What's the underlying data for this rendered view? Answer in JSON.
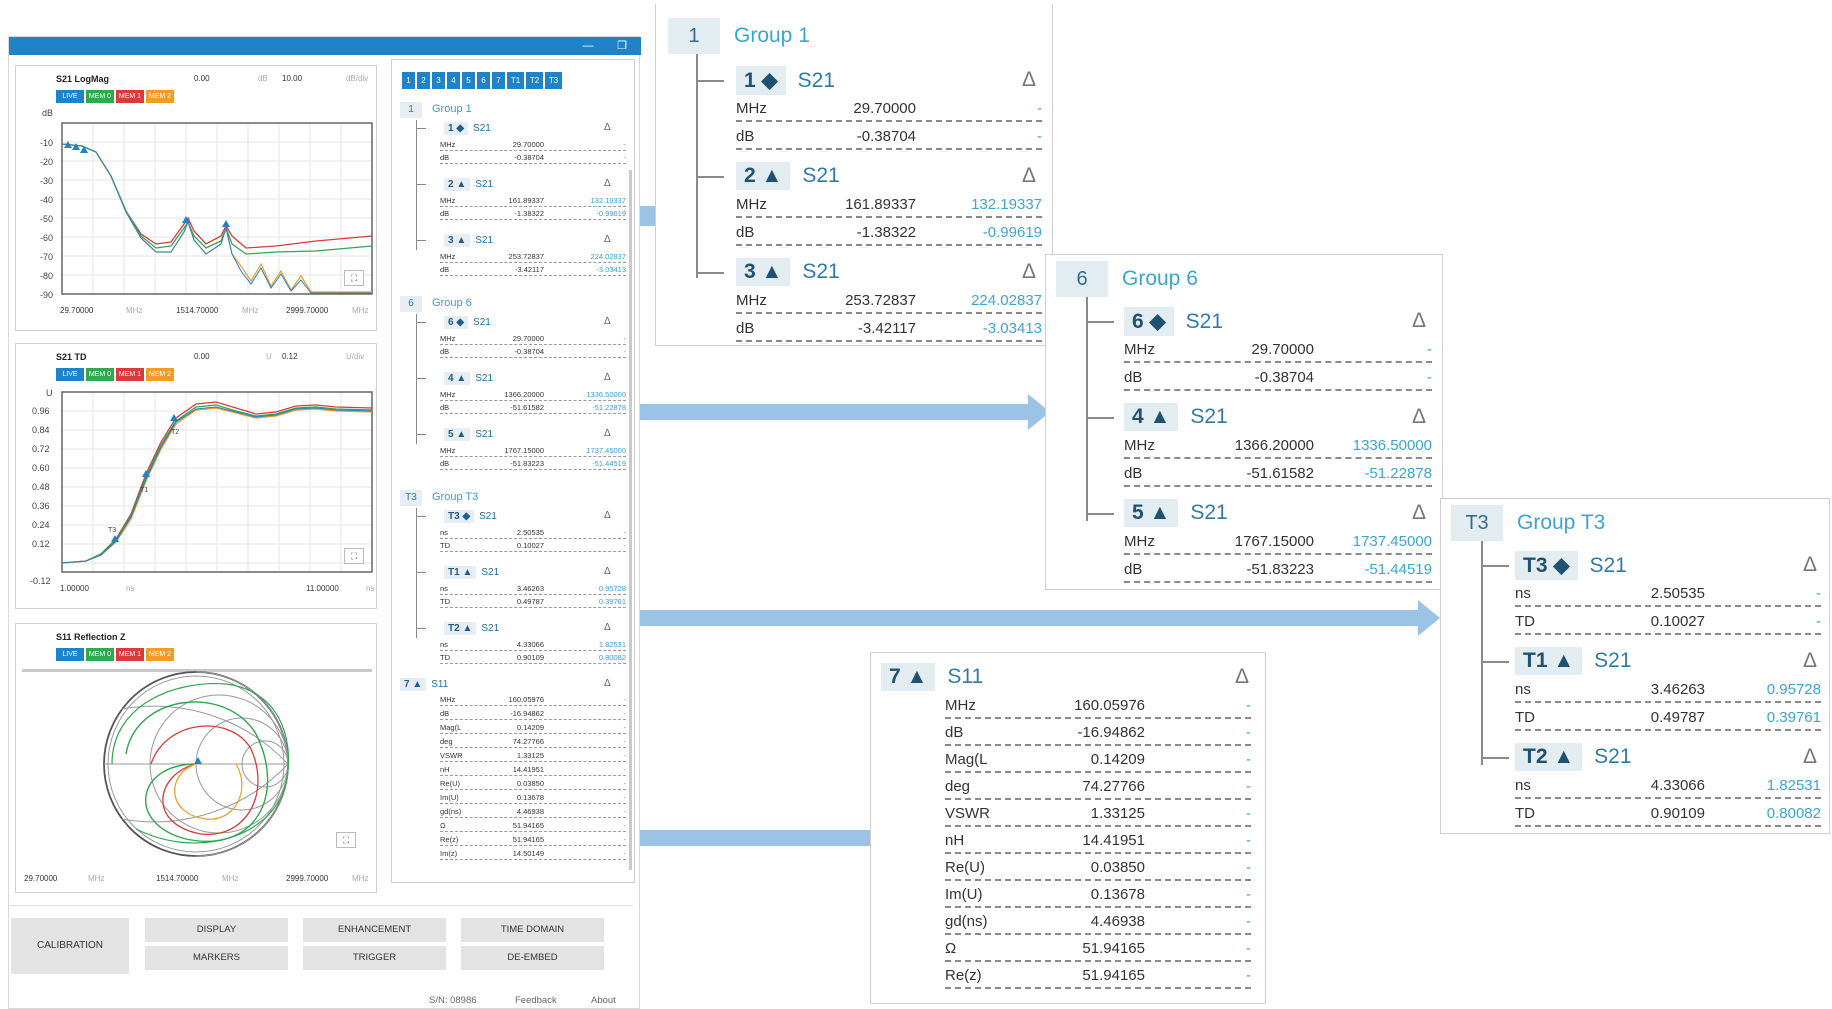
{
  "colors": {
    "accent": "#1f83c9",
    "live": "#1f83c9",
    "mem0": "#2fa84f",
    "mem1": "#d93a3a",
    "mem2": "#f39b24",
    "delta_text": "#3ba6cd"
  },
  "window": {
    "min_icon": "minimize-icon",
    "restore_icon": "restore-icon"
  },
  "mem_labels": [
    "LIVE",
    "MEM 0",
    "MEM 1",
    "MEM 2"
  ],
  "plot1": {
    "title": "S21 LogMag",
    "ref": "0.00",
    "ref_unit": "dB",
    "scale": "10.00",
    "scale_unit": "dB/div",
    "y_unit": "dB",
    "y_ticks": [
      "-10",
      "-20",
      "-30",
      "-40",
      "-50",
      "-60",
      "-70",
      "-80",
      "-90"
    ],
    "x_start": "29.70000",
    "x_start_unit": "MHz",
    "x_mid": "1514.70000",
    "x_mid_unit": "MHz",
    "x_end": "2999.70000",
    "x_end_unit": "MHz",
    "markers": [
      "1",
      "2",
      "3",
      "4",
      "5"
    ]
  },
  "plot2": {
    "title": "S21 TD",
    "ref": "0.00",
    "ref_unit": "U",
    "scale": "0.12",
    "scale_unit": "U/div",
    "y_unit": "U",
    "y_ticks": [
      "0.96",
      "0.84",
      "0.72",
      "0.60",
      "0.48",
      "0.36",
      "0.24",
      "0.12",
      "-0.12"
    ],
    "x_start": "1.00000",
    "x_start_unit": "ns",
    "x_end": "11.00000",
    "x_end_unit": "ns",
    "markers": [
      "T1",
      "T2",
      "T3"
    ]
  },
  "plot3": {
    "title": "S11 Reflection Z",
    "x_start": "29.70000",
    "x_start_unit": "MHz",
    "x_mid": "1514.70000",
    "x_mid_unit": "MHz",
    "x_end": "2999.70000",
    "x_end_unit": "MHz"
  },
  "marker_tabs": [
    "1",
    "2",
    "3",
    "4",
    "5",
    "6",
    "7",
    "T1",
    "T2",
    "T3"
  ],
  "delta_symbol": "Δ",
  "groups": {
    "g1": {
      "id": "1",
      "label": "Group 1",
      "m1": {
        "id": "1 ◆",
        "trace": "S21",
        "rows": [
          [
            "MHz",
            "29.70000",
            "-"
          ],
          [
            "dB",
            "-0.38704",
            "-"
          ]
        ]
      },
      "m2": {
        "id": "2 ▲",
        "trace": "S21",
        "rows": [
          [
            "MHz",
            "161.89337",
            "132.19337"
          ],
          [
            "dB",
            "-1.38322",
            "-0.99619"
          ]
        ]
      },
      "m3": {
        "id": "3 ▲",
        "trace": "S21",
        "rows": [
          [
            "MHz",
            "253.72837",
            "224.02837"
          ],
          [
            "dB",
            "-3.42117",
            "-3.03413"
          ]
        ]
      }
    },
    "g6": {
      "id": "6",
      "label": "Group 6",
      "m6": {
        "id": "6 ◆",
        "trace": "S21",
        "rows": [
          [
            "MHz",
            "29.70000",
            "-"
          ],
          [
            "dB",
            "-0.38704",
            "-"
          ]
        ]
      },
      "m4": {
        "id": "4 ▲",
        "trace": "S21",
        "rows": [
          [
            "MHz",
            "1366.20000",
            "1336.50000"
          ],
          [
            "dB",
            "-51.61582",
            "-51.22878"
          ]
        ]
      },
      "m5": {
        "id": "5 ▲",
        "trace": "S21",
        "rows": [
          [
            "MHz",
            "1767.15000",
            "1737.45000"
          ],
          [
            "dB",
            "-51.83223",
            "-51.44519"
          ]
        ]
      }
    },
    "gT3": {
      "id": "T3",
      "label": "Group T3",
      "mT3": {
        "id": "T3 ◆",
        "trace": "S21",
        "rows": [
          [
            "ns",
            "2.50535",
            "-"
          ],
          [
            "TD",
            "0.10027",
            "-"
          ]
        ]
      },
      "mT1": {
        "id": "T1 ▲",
        "trace": "S21",
        "rows": [
          [
            "ns",
            "3.46263",
            "0.95728"
          ],
          [
            "TD",
            "0.49787",
            "0.39761"
          ]
        ]
      },
      "mT2": {
        "id": "T2 ▲",
        "trace": "S21",
        "rows": [
          [
            "ns",
            "4.33066",
            "1.82531"
          ],
          [
            "TD",
            "0.90109",
            "0.80082"
          ]
        ]
      }
    },
    "m7": {
      "id": "7 ▲",
      "trace": "S11",
      "rows": [
        [
          "MHz",
          "160.05976",
          "-"
        ],
        [
          "dB",
          "-16.94862",
          "-"
        ],
        [
          "Mag(L",
          "0.14209",
          "-"
        ],
        [
          "deg",
          "74.27766",
          "-"
        ],
        [
          "VSWR",
          "1.33125",
          "-"
        ],
        [
          "nH",
          "14.41951",
          "-"
        ],
        [
          "Re(U)",
          "0.03850",
          "-"
        ],
        [
          "Im(U)",
          "0.13678",
          "-"
        ],
        [
          "gd(ns)",
          "4.46938",
          "-"
        ],
        [
          "Ω",
          "51.94165",
          "-"
        ],
        [
          "Re(z)",
          "51.94165",
          "-"
        ],
        [
          "Im(z)",
          "14.50149",
          "-"
        ]
      ]
    }
  },
  "buttons": {
    "calibration": "CALIBRATION",
    "display": "DISPLAY",
    "enhancement": "ENHANCEMENT",
    "time_domain": "TIME DOMAIN",
    "markers": "MARKERS",
    "trigger": "TRIGGER",
    "de_embed": "DE-EMBED"
  },
  "status": {
    "serial": "S/N: 08986",
    "feedback": "Feedback",
    "about": "About"
  }
}
